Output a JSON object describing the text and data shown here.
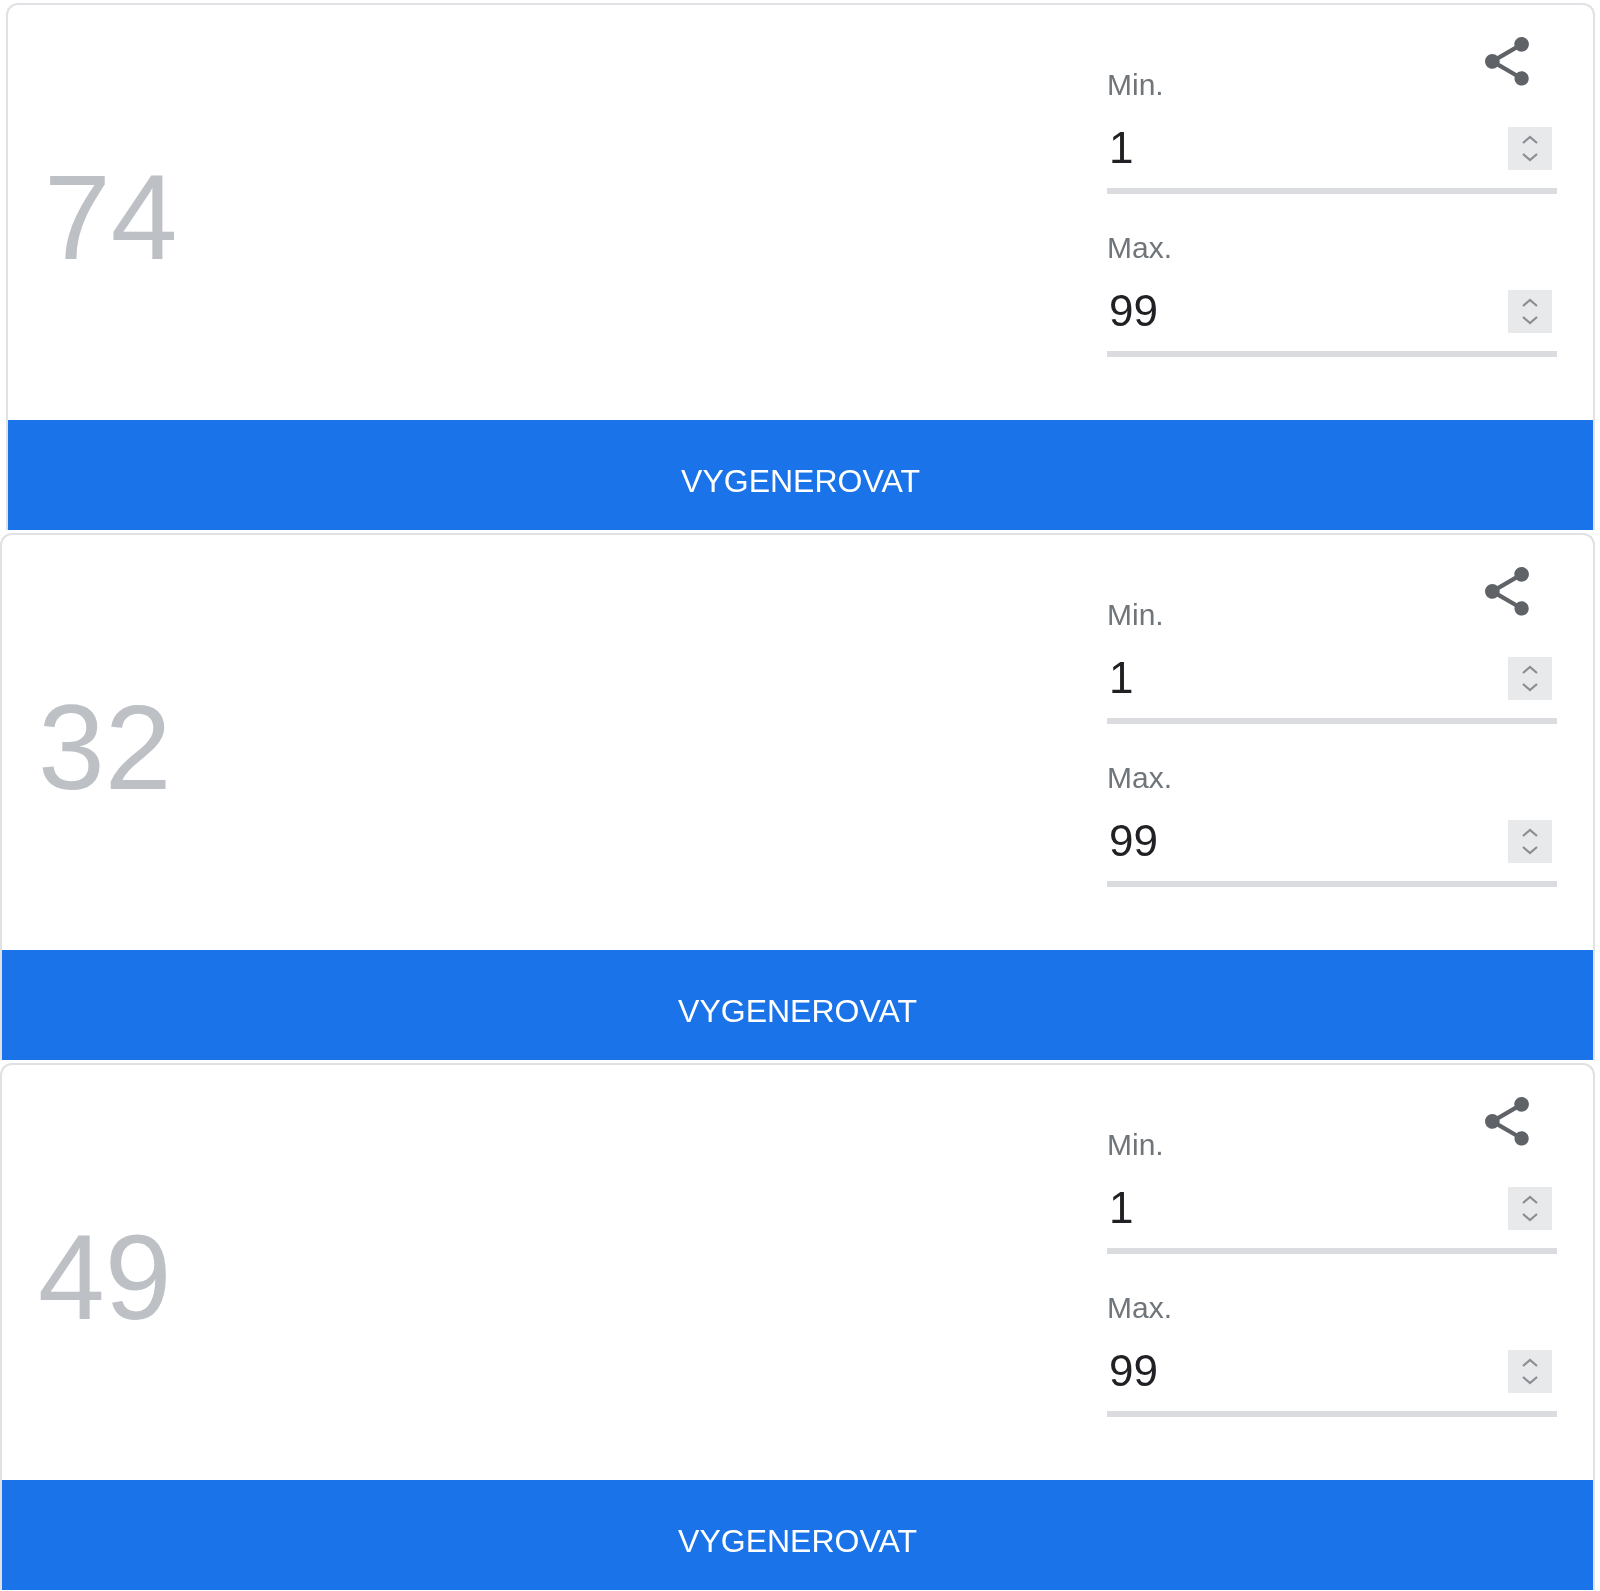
{
  "cards": [
    {
      "number": "74",
      "fields": [
        {
          "label": "Min.",
          "value": "1"
        },
        {
          "label": "Max.",
          "value": "99"
        }
      ],
      "button": "VYGENEROVAT"
    },
    {
      "number": "32",
      "fields": [
        {
          "label": "Min.",
          "value": "1"
        },
        {
          "label": "Max.",
          "value": "99"
        }
      ],
      "button": "VYGENEROVAT"
    },
    {
      "number": "49",
      "fields": [
        {
          "label": "Min.",
          "value": "1"
        },
        {
          "label": "Max.",
          "value": "99"
        }
      ],
      "button": "VYGENEROVAT"
    }
  ]
}
